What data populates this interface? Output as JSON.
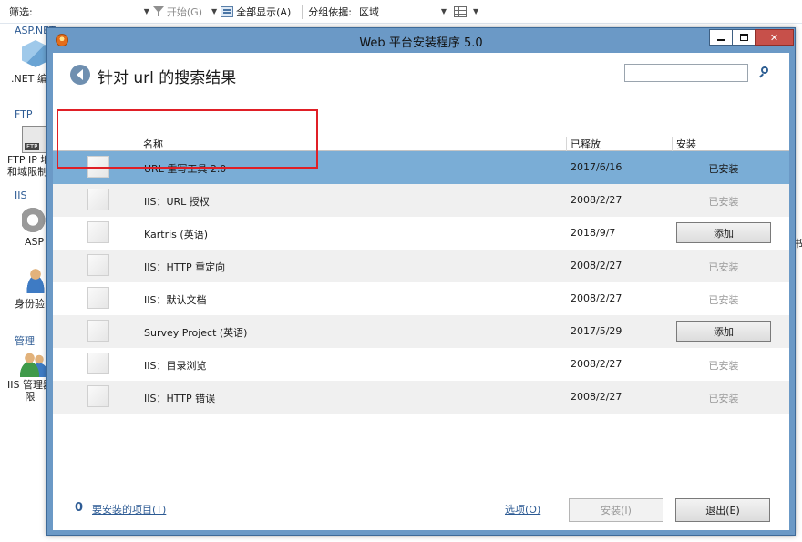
{
  "background": {
    "toolbar": {
      "filter_label": "筛选:",
      "start_label": "开始(G)",
      "show_all_label": "全部显示(A)",
      "group_by_label": "分组依据:",
      "group_by_value": "区域"
    },
    "groups": [
      "ASP.NET",
      "FTP",
      "IIS",
      "管理"
    ],
    "items": {
      "net": ".NET 编",
      "ftp_line1": "FTP IP 地",
      "ftp_line2": "和域限制",
      "asp": "ASP",
      "auth": "身份验证",
      "admin_line1": "IIS 管理器",
      "admin_line2": "限"
    },
    "right_text": "书"
  },
  "dialog": {
    "title": "Web 平台安装程序 5.0",
    "search_title": "针对 url 的搜索结果",
    "search_value": "",
    "columns": {
      "name": "名称",
      "date": "已释放",
      "install": "安装"
    },
    "rows": [
      {
        "name": "URL 重写工具 2.0",
        "date": "2017/6/16",
        "status": "已安装"
      },
      {
        "name": "IIS：URL 授权",
        "date": "2008/2/27",
        "status": "已安装"
      },
      {
        "name": "Kartris (英语)",
        "date": "2018/9/7",
        "action": "添加"
      },
      {
        "name": "IIS：HTTP 重定向",
        "date": "2008/2/27",
        "status": "已安装"
      },
      {
        "name": "IIS：默认文档",
        "date": "2008/2/27",
        "status": "已安装"
      },
      {
        "name": "Survey Project (英语)",
        "date": "2017/5/29",
        "action": "添加"
      },
      {
        "name": "IIS：目录浏览",
        "date": "2008/2/27",
        "status": "已安装"
      },
      {
        "name": "IIS：HTTP 错误",
        "date": "2008/2/27",
        "status": "已安装"
      }
    ],
    "footer": {
      "count": "0",
      "items_link": "要安装的项目(T)",
      "options_link": "选项(O)",
      "install_button": "安装(I)",
      "exit_button": "退出(E)"
    }
  },
  "colors": {
    "title_bar": "#6b99c6",
    "selected_row": "#7aadd6",
    "highlight": "#e01f26",
    "link": "#2d5b94"
  }
}
